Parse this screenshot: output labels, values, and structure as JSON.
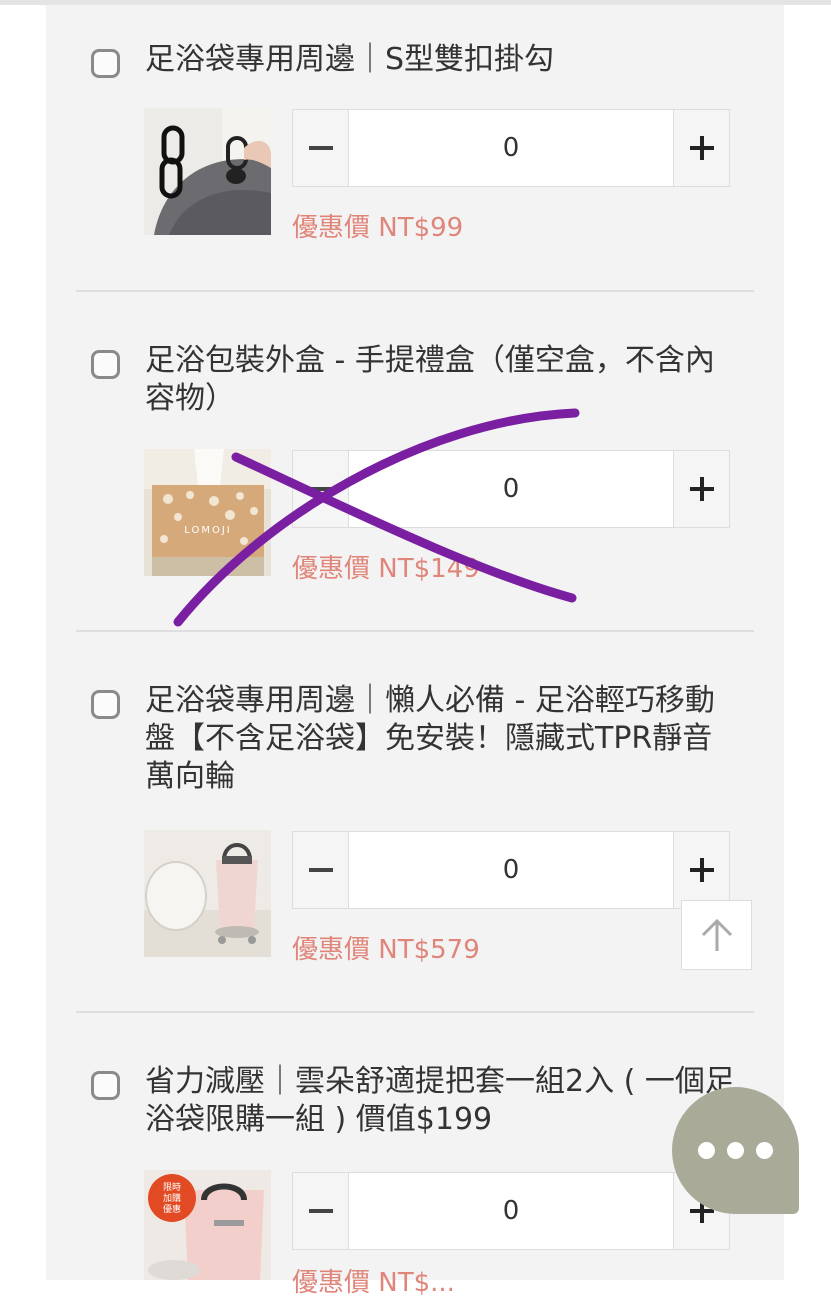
{
  "products": [
    {
      "title": "足浴袋專用周邊｜S型雙扣掛勾",
      "image": "s-hook-photo",
      "quantity": "0",
      "price": "優惠價 NT$99"
    },
    {
      "title": "足浴包裝外盒 - 手提禮盒（僅空盒，不含內容物）",
      "image": "gift-box-photo",
      "image_text": "LOMOJI",
      "quantity": "0",
      "price": "優惠價 NT$149",
      "crossed_out": true
    },
    {
      "title": "足浴袋專用周邊｜懶人必備 - 足浴輕巧移動盤【不含足浴袋】免安裝！隱藏式TPR靜音萬向輪",
      "image": "mobile-tray-photo",
      "quantity": "0",
      "price": "優惠價 NT$579"
    },
    {
      "title": "省力減壓｜雲朵舒適提把套一組2入 ( 一個足浴袋限購一組 ) 價值$199",
      "image": "handle-cover-photo",
      "badge": "限時\n加購\n優惠",
      "quantity": "0",
      "price": "優惠價 NT$..."
    }
  ],
  "icons": {
    "minus": "minus-icon",
    "plus": "plus-icon",
    "scroll_top": "arrow-up-icon",
    "chat": "chat-bubble-icon"
  },
  "colors": {
    "price": "#e0857a",
    "chat_bubble": "#a9ab98",
    "cross_mark": "#7a1fa2",
    "badge": "#e14a23"
  }
}
